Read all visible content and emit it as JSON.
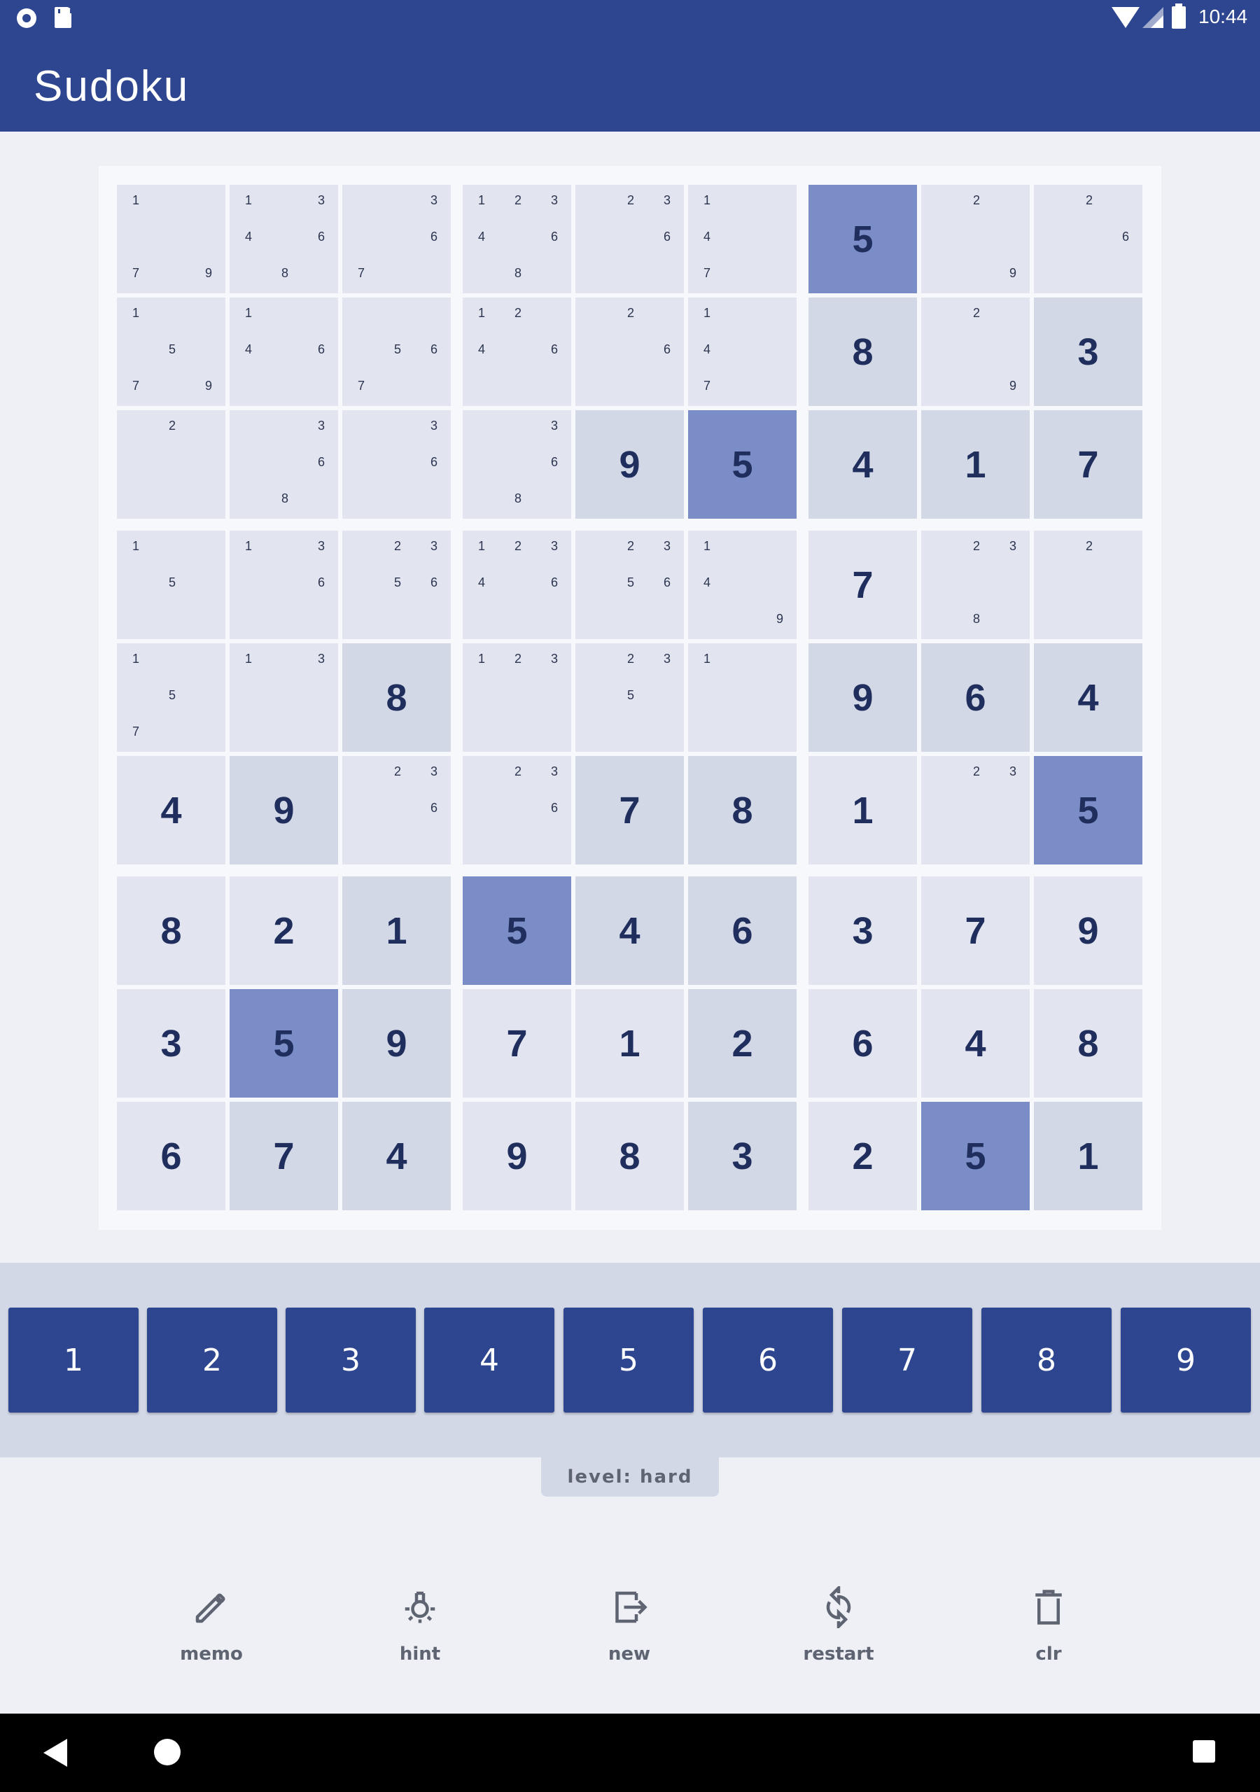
{
  "status_bar": {
    "time": "10:44"
  },
  "app": {
    "title": "Sudoku"
  },
  "board": {
    "cells": [
      [
        {
          "n": [
            1,
            7,
            9
          ]
        },
        {
          "n": [
            1,
            3,
            4,
            6,
            8
          ]
        },
        {
          "n": [
            3,
            6,
            7
          ]
        },
        {
          "n": [
            1,
            2,
            3,
            4,
            6,
            8
          ]
        },
        {
          "n": [
            2,
            3,
            6
          ]
        },
        {
          "n": [
            1,
            4,
            7
          ]
        },
        {
          "v": 5,
          "shade": "sel"
        },
        {
          "n": [
            2,
            9
          ]
        },
        {
          "n": [
            2,
            6
          ]
        }
      ],
      [
        {
          "n": [
            1,
            5,
            7,
            9
          ]
        },
        {
          "n": [
            1,
            4,
            6
          ]
        },
        {
          "n": [
            5,
            6,
            7
          ]
        },
        {
          "n": [
            1,
            2,
            4,
            6
          ]
        },
        {
          "n": [
            2,
            6
          ]
        },
        {
          "n": [
            1,
            4,
            7
          ]
        },
        {
          "v": 8,
          "shade": "dark"
        },
        {
          "n": [
            2,
            9
          ]
        },
        {
          "v": 3,
          "shade": "dark"
        }
      ],
      [
        {
          "n": [
            2
          ]
        },
        {
          "n": [
            3,
            6,
            8
          ]
        },
        {
          "n": [
            3,
            6
          ]
        },
        {
          "n": [
            3,
            6,
            8
          ]
        },
        {
          "v": 9,
          "shade": "dark"
        },
        {
          "v": 5,
          "shade": "sel"
        },
        {
          "v": 4,
          "shade": "dark"
        },
        {
          "v": 1,
          "shade": "dark"
        },
        {
          "v": 7,
          "shade": "dark"
        }
      ],
      [
        {
          "n": [
            1,
            5
          ]
        },
        {
          "n": [
            1,
            3,
            6
          ]
        },
        {
          "n": [
            2,
            3,
            5,
            6
          ]
        },
        {
          "n": [
            1,
            2,
            3,
            4,
            6
          ]
        },
        {
          "n": [
            2,
            3,
            5,
            6
          ]
        },
        {
          "n": [
            1,
            4,
            9
          ]
        },
        {
          "v": 7,
          "shade": "light"
        },
        {
          "n": [
            2,
            3,
            8
          ]
        },
        {
          "n": [
            2
          ]
        }
      ],
      [
        {
          "n": [
            1,
            5,
            7
          ]
        },
        {
          "n": [
            1,
            3
          ]
        },
        {
          "v": 8,
          "shade": "dark"
        },
        {
          "n": [
            1,
            2,
            3
          ]
        },
        {
          "n": [
            2,
            3,
            5
          ]
        },
        {
          "n": [
            1
          ]
        },
        {
          "v": 9,
          "shade": "dark"
        },
        {
          "v": 6,
          "shade": "dark"
        },
        {
          "v": 4,
          "shade": "dark"
        }
      ],
      [
        {
          "v": 4,
          "shade": "light"
        },
        {
          "v": 9,
          "shade": "dark"
        },
        {
          "n": [
            2,
            3,
            6
          ]
        },
        {
          "n": [
            2,
            3,
            6
          ]
        },
        {
          "v": 7,
          "shade": "dark"
        },
        {
          "v": 8,
          "shade": "dark"
        },
        {
          "v": 1,
          "shade": "light"
        },
        {
          "n": [
            2,
            3
          ]
        },
        {
          "v": 5,
          "shade": "sel"
        }
      ],
      [
        {
          "v": 8,
          "shade": "light"
        },
        {
          "v": 2,
          "shade": "light"
        },
        {
          "v": 1,
          "shade": "dark"
        },
        {
          "v": 5,
          "shade": "sel"
        },
        {
          "v": 4,
          "shade": "dark"
        },
        {
          "v": 6,
          "shade": "dark"
        },
        {
          "v": 3,
          "shade": "light"
        },
        {
          "v": 7,
          "shade": "light"
        },
        {
          "v": 9,
          "shade": "light"
        }
      ],
      [
        {
          "v": 3,
          "shade": "light"
        },
        {
          "v": 5,
          "shade": "sel"
        },
        {
          "v": 9,
          "shade": "dark"
        },
        {
          "v": 7,
          "shade": "light"
        },
        {
          "v": 1,
          "shade": "light"
        },
        {
          "v": 2,
          "shade": "dark"
        },
        {
          "v": 6,
          "shade": "light"
        },
        {
          "v": 4,
          "shade": "light"
        },
        {
          "v": 8,
          "shade": "light"
        }
      ],
      [
        {
          "v": 6,
          "shade": "light"
        },
        {
          "v": 7,
          "shade": "dark"
        },
        {
          "v": 4,
          "shade": "dark"
        },
        {
          "v": 9,
          "shade": "light"
        },
        {
          "v": 8,
          "shade": "light"
        },
        {
          "v": 3,
          "shade": "dark"
        },
        {
          "v": 2,
          "shade": "light"
        },
        {
          "v": 5,
          "shade": "sel"
        },
        {
          "v": 1,
          "shade": "dark"
        }
      ]
    ]
  },
  "number_pad": [
    "1",
    "2",
    "3",
    "4",
    "5",
    "6",
    "7",
    "8",
    "9"
  ],
  "level": "level: hard",
  "tools": [
    {
      "label": "memo",
      "icon": "pencil-icon"
    },
    {
      "label": "hint",
      "icon": "lightbulb-icon"
    },
    {
      "label": "new",
      "icon": "exit-icon"
    },
    {
      "label": "restart",
      "icon": "refresh-icon"
    },
    {
      "label": "clr",
      "icon": "trash-icon"
    }
  ],
  "colors": {
    "primary": "#2e4690",
    "selected_cell": "#7a8dc7",
    "cell_light": "#e2e5f0",
    "cell_dark": "#d3d8e7",
    "background": "#eef0f5"
  }
}
